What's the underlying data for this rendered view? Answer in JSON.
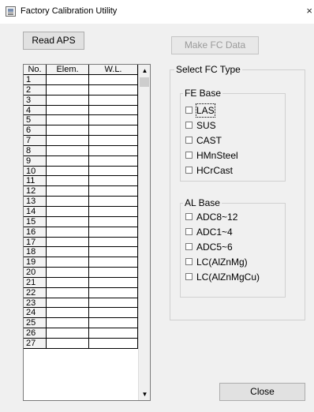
{
  "window": {
    "title": "Factory Calibration Utility",
    "close_glyph": "×"
  },
  "toolbar": {
    "read_label": "Read APS",
    "make_label": "Make FC Data"
  },
  "grid": {
    "headers": [
      "No.",
      "Elem.",
      "W.L."
    ],
    "rows": [
      "1",
      "2",
      "3",
      "4",
      "5",
      "6",
      "7",
      "8",
      "9",
      "10",
      "11",
      "12",
      "13",
      "14",
      "15",
      "16",
      "17",
      "18",
      "19",
      "20",
      "21",
      "22",
      "23",
      "24",
      "25",
      "26",
      "27"
    ]
  },
  "fc_type": {
    "title": "Select FC Type",
    "fe": {
      "title": "FE Base",
      "options": [
        "LAS",
        "SUS",
        "CAST",
        "HMnSteel",
        "HCrCast"
      ]
    },
    "al": {
      "title": "AL Base",
      "options": [
        "ADC8~12",
        "ADC1~4",
        "ADC5~6",
        "LC(AlZnMg)",
        "LC(AlZnMgCu)"
      ]
    }
  },
  "footer": {
    "close_label": "Close"
  },
  "icons": {
    "scroll_up": "▲",
    "scroll_down": "▼"
  }
}
